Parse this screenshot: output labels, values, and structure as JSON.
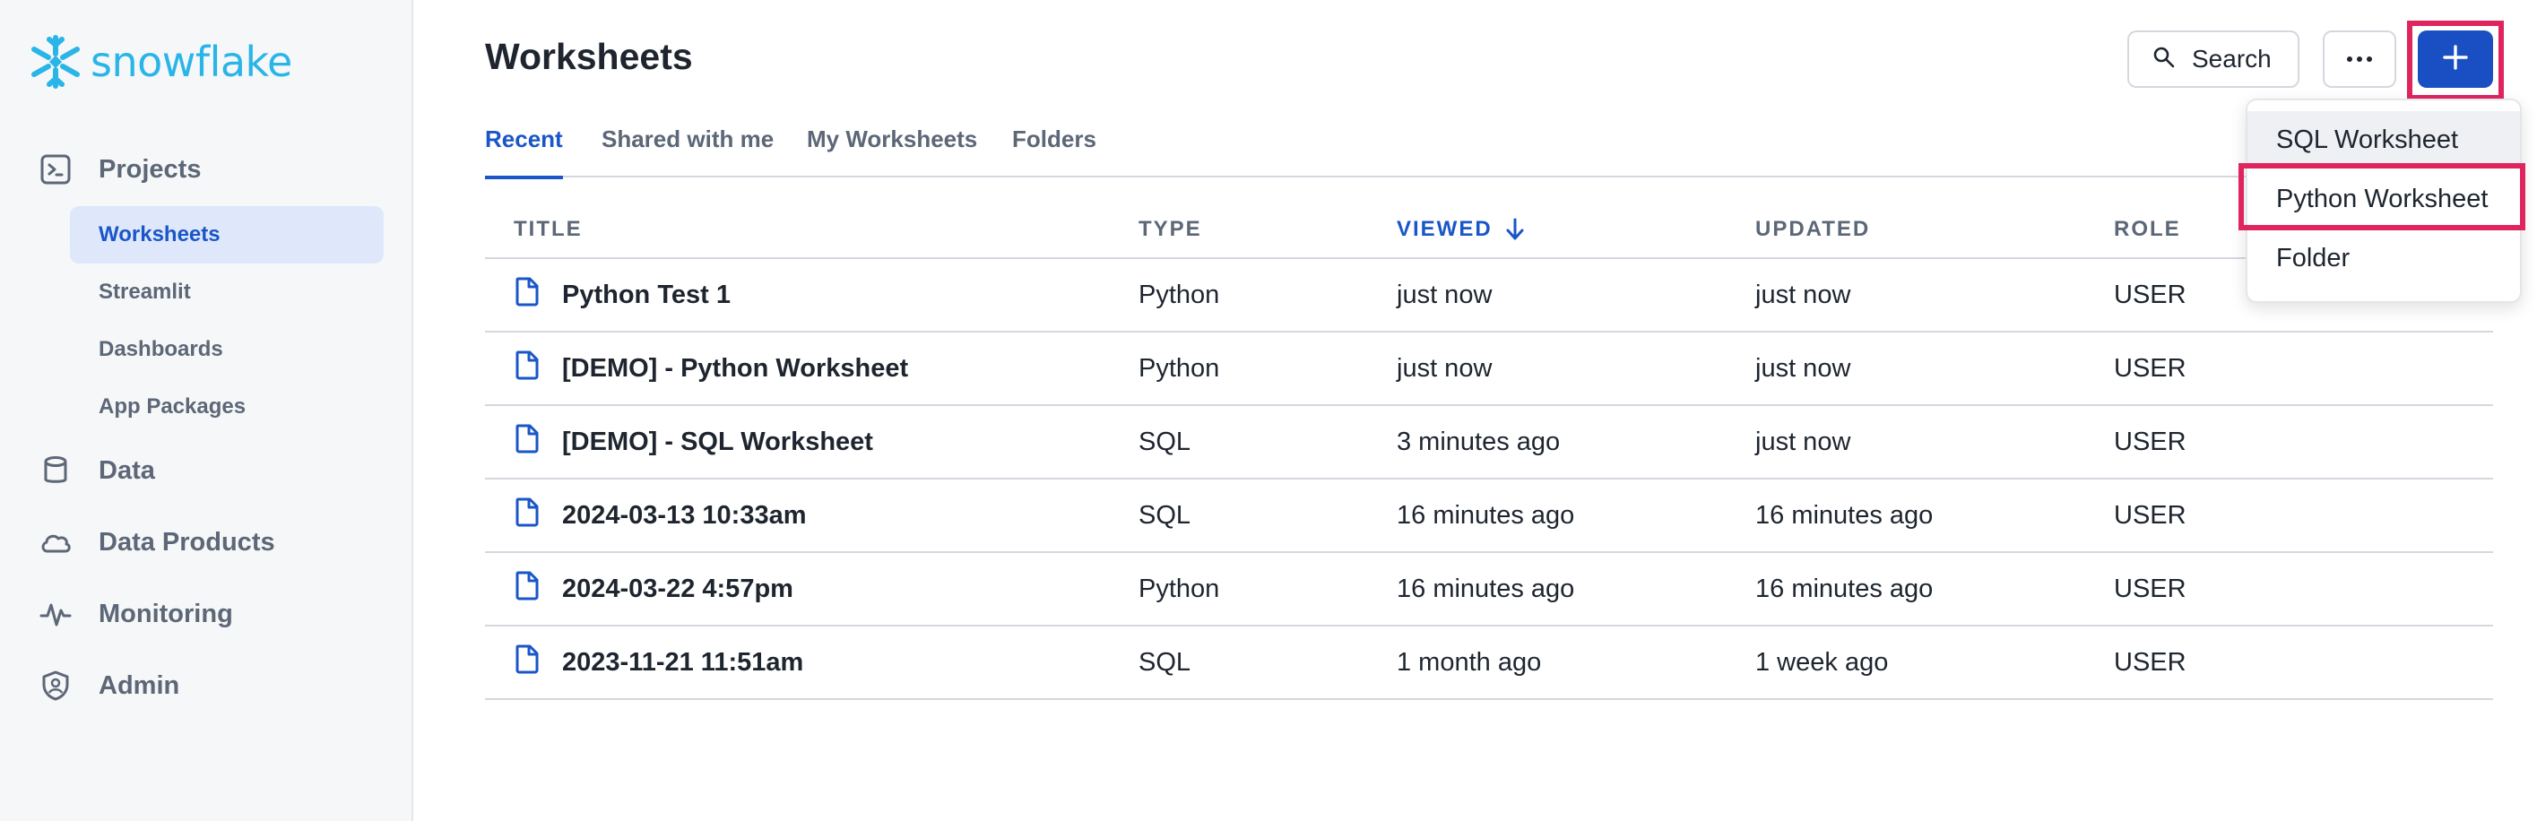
{
  "brand": {
    "name": "snowflake",
    "color": "#29b5e8"
  },
  "sidebar": {
    "items": [
      {
        "label": "Projects",
        "icon": "terminal-icon"
      },
      {
        "label": "Data",
        "icon": "database-icon"
      },
      {
        "label": "Data Products",
        "icon": "cloud-icon"
      },
      {
        "label": "Monitoring",
        "icon": "activity-icon"
      },
      {
        "label": "Admin",
        "icon": "shield-user-icon"
      }
    ],
    "sub_items": [
      {
        "label": "Worksheets",
        "active": true
      },
      {
        "label": "Streamlit"
      },
      {
        "label": "Dashboards"
      },
      {
        "label": "App Packages"
      }
    ]
  },
  "header": {
    "title": "Worksheets",
    "search_label": "Search",
    "more_icon": "ellipsis-icon",
    "add_icon": "plus-icon"
  },
  "tabs": [
    {
      "label": "Recent",
      "active": true
    },
    {
      "label": "Shared with me"
    },
    {
      "label": "My Worksheets"
    },
    {
      "label": "Folders"
    }
  ],
  "table": {
    "columns": [
      "TITLE",
      "TYPE",
      "VIEWED",
      "UPDATED",
      "ROLE"
    ],
    "sorted_column": "VIEWED",
    "rows": [
      {
        "title": "Python Test 1",
        "type": "Python",
        "viewed": "just now",
        "updated": "just now",
        "role": "USER"
      },
      {
        "title": "[DEMO] - Python Worksheet",
        "type": "Python",
        "viewed": "just now",
        "updated": "just now",
        "role": "USER"
      },
      {
        "title": "[DEMO] - SQL Worksheet",
        "type": "SQL",
        "viewed": "3 minutes ago",
        "updated": "just now",
        "role": "USER"
      },
      {
        "title": "2024-03-13 10:33am",
        "type": "SQL",
        "viewed": "16 minutes ago",
        "updated": "16 minutes ago",
        "role": "USER"
      },
      {
        "title": "2024-03-22 4:57pm",
        "type": "Python",
        "viewed": "16 minutes ago",
        "updated": "16 minutes ago",
        "role": "USER"
      },
      {
        "title": "2023-11-21 11:51am",
        "type": "SQL",
        "viewed": "1 month ago",
        "updated": "1 week ago",
        "role": "USER"
      }
    ]
  },
  "dropdown": {
    "items": [
      "SQL Worksheet",
      "Python Worksheet",
      "Folder"
    ]
  },
  "colors": {
    "accent": "#1a56c8",
    "primary_button": "#1a4fc4",
    "highlight": "#e0245e"
  }
}
